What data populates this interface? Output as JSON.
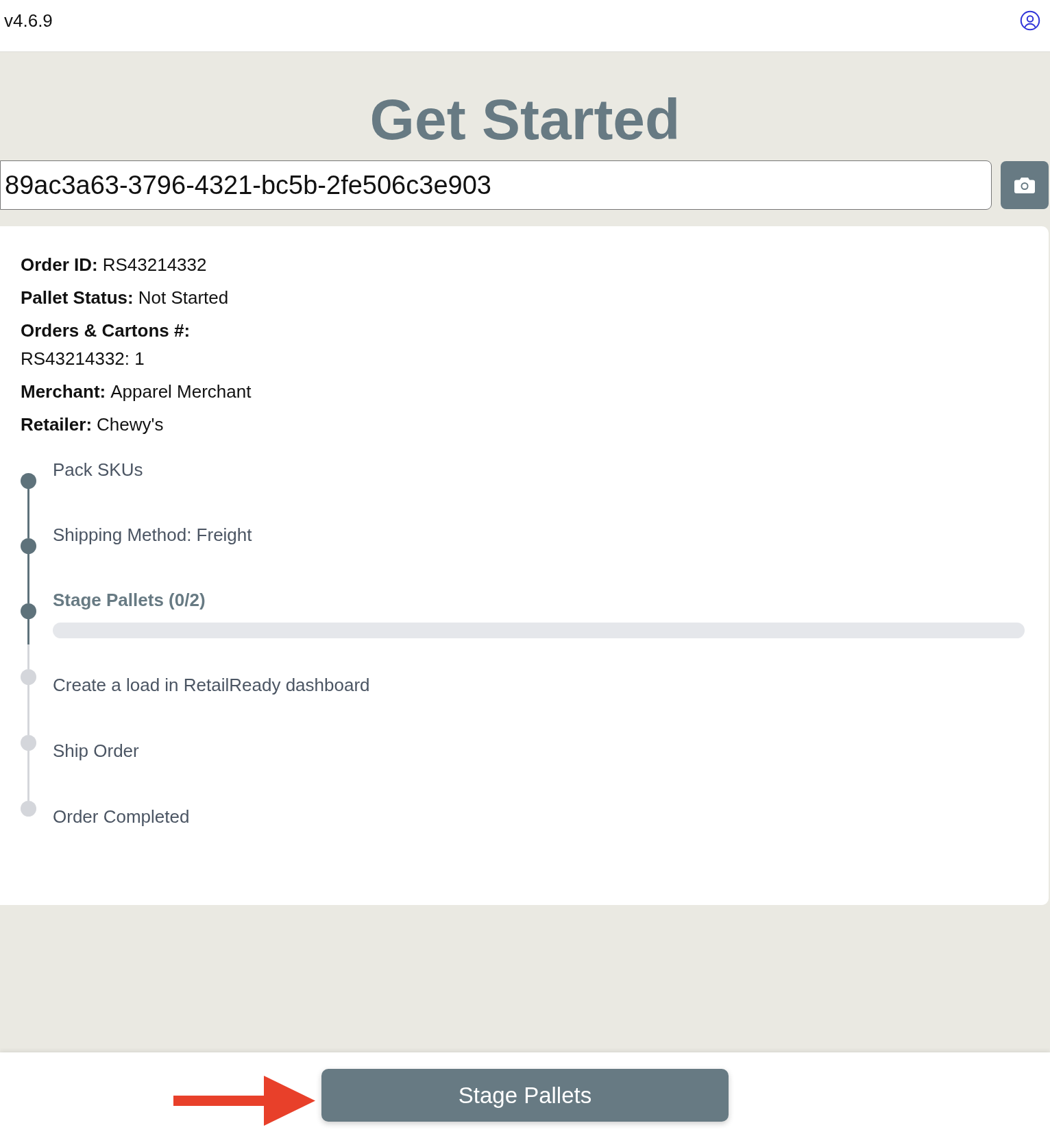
{
  "header": {
    "version": "v4.6.9"
  },
  "title": "Get Started",
  "scan_field": {
    "value": "89ac3a63-3796-4321-bc5b-2fe506c3e903"
  },
  "order_details": [
    {
      "kind": "inline",
      "label": "Order ID:",
      "value": "RS43214332"
    },
    {
      "kind": "inline",
      "label": "Pallet Status:",
      "value": "Not Started"
    },
    {
      "kind": "block",
      "label": "Orders & Cartons #:",
      "value": "RS43214332: 1"
    },
    {
      "kind": "inline",
      "label": "Merchant:",
      "value": "Apparel Merchant"
    },
    {
      "kind": "inline",
      "label": "Retailer:",
      "value": "Chewy's"
    }
  ],
  "steps": [
    {
      "label": "Pack SKUs",
      "reached": true,
      "current": false
    },
    {
      "label": "Shipping Method: Freight",
      "reached": true,
      "current": false
    },
    {
      "label": "Stage Pallets (0/2)",
      "reached": true,
      "current": true,
      "progress": {
        "level": 0
      }
    },
    {
      "label": "Create a load in RetailReady dashboard",
      "reached": false,
      "current": false
    },
    {
      "label": "Ship Order",
      "reached": false,
      "current": false
    },
    {
      "label": "Order Completed",
      "reached": false,
      "current": false
    }
  ],
  "footer": {
    "button": "Stage Pallets"
  }
}
